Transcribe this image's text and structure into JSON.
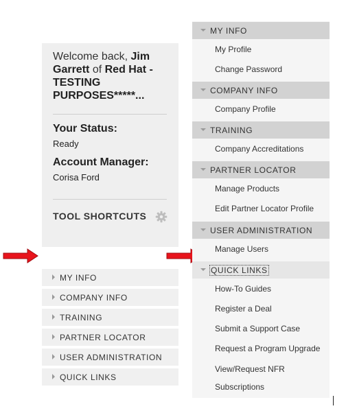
{
  "welcome": {
    "greeting": "Welcome back,",
    "user_name": "Jim Garrett",
    "of_text": "of",
    "company": "Red Hat - TESTING PURPOSES*****...",
    "status_label": "Your Status:",
    "status_value": "Ready",
    "manager_label": "Account Manager:",
    "manager_value": "Corisa Ford",
    "tool_shortcuts": "TOOL SHORTCUTS",
    "gear_icon": "gear-icon"
  },
  "collapsed_menu": [
    {
      "label": "MY INFO"
    },
    {
      "label": "COMPANY INFO"
    },
    {
      "label": "TRAINING"
    },
    {
      "label": "PARTNER LOCATOR"
    },
    {
      "label": "USER ADMINISTRATION"
    },
    {
      "label": "QUICK LINKS"
    }
  ],
  "expanded_menu": {
    "my_info": {
      "label": "MY INFO",
      "links": [
        "My Profile",
        "Change Password"
      ]
    },
    "company_info": {
      "label": "COMPANY INFO",
      "links": [
        "Company Profile"
      ]
    },
    "training": {
      "label": "TRAINING",
      "links": [
        "Company Accreditations"
      ]
    },
    "partner_locator": {
      "label": "PARTNER LOCATOR",
      "links": [
        "Manage Products",
        "Edit Partner Locator Profile"
      ]
    },
    "user_admin": {
      "label": "USER ADMINISTRATION",
      "links": [
        "Manage Users"
      ]
    },
    "quick_links": {
      "label": "QUICK LINKS",
      "links": [
        "How-To Guides",
        "Register a Deal",
        "Submit a Support Case",
        "Request a Program Upgrade",
        "View/Request NFR",
        "Subscriptions"
      ]
    }
  },
  "colors": {
    "arrow": "#e8141c",
    "header_bg": "#d2d2d2",
    "card_bg": "#efefef"
  }
}
